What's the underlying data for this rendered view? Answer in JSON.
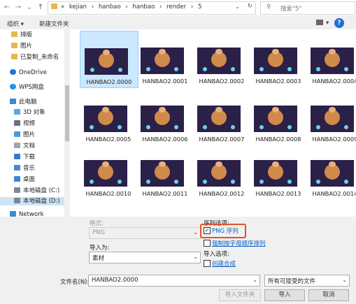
{
  "address": {
    "crumbs": [
      "«",
      "kejian",
      "›",
      "hanbao",
      "›",
      "hanbao",
      "›",
      "render",
      "›",
      "5"
    ],
    "search_placeholder": "搜索\"5\""
  },
  "toolbar": {
    "organize": "组织 ▾",
    "new_folder": "新建文件夹"
  },
  "sidebar": {
    "items": [
      {
        "label": "排版",
        "icon": "folder-icon"
      },
      {
        "label": "图片",
        "icon": "folder-icon"
      },
      {
        "label": "已复制_未命名",
        "icon": "folder-icon"
      },
      {
        "label": "OneDrive",
        "icon": "cloud-icon"
      },
      {
        "label": "WPS网盘",
        "icon": "cloud-icon"
      },
      {
        "label": "此电脑",
        "icon": "computer-icon"
      },
      {
        "label": "3D 对象",
        "icon": "cube-icon"
      },
      {
        "label": "视频",
        "icon": "video-icon"
      },
      {
        "label": "图片",
        "icon": "pictures-icon"
      },
      {
        "label": "文档",
        "icon": "document-icon"
      },
      {
        "label": "下载",
        "icon": "download-icon"
      },
      {
        "label": "音乐",
        "icon": "music-icon"
      },
      {
        "label": "桌面",
        "icon": "desktop-icon"
      },
      {
        "label": "本地磁盘 (C:)",
        "icon": "drive-icon"
      },
      {
        "label": "本地磁盘 (D:)",
        "icon": "drive-icon"
      },
      {
        "label": "Network",
        "icon": "network-icon"
      }
    ]
  },
  "files": [
    "HANBAO2.0000",
    "HANBAO2.0001",
    "HANBAO2.0002",
    "HANBAO2.0003",
    "HANBAO2.0004",
    "HANBAO2.0005",
    "HANBAO2.0006",
    "HANBAO2.0007",
    "HANBAO2.0008",
    "HANBAO2.0009",
    "HANBAO2.0010",
    "HANBAO2.0011",
    "HANBAO2.0012",
    "HANBAO2.0013",
    "HANBAO2.0014"
  ],
  "options": {
    "format_label": "格式:",
    "format_value": "PNG",
    "import_as_label": "导入为:",
    "import_as_value": "素材",
    "sequence_label": "序列选项:",
    "png_sequence": "PNG 序列",
    "force_alpha": "强制按字母顺序排列",
    "import_options_label": "导入选项:",
    "create_comp": "创建合成"
  },
  "footer": {
    "filename_label": "文件名(N):",
    "filename_value": "HANBAO2.0000",
    "filter_value": "所有可接受的文件",
    "import_folder": "导入文件夹",
    "import": "导入",
    "cancel": "取消"
  },
  "colors": {
    "selection": "#cce8ff",
    "highlight_border": "#e0532a",
    "accent": "#0a64c8"
  }
}
